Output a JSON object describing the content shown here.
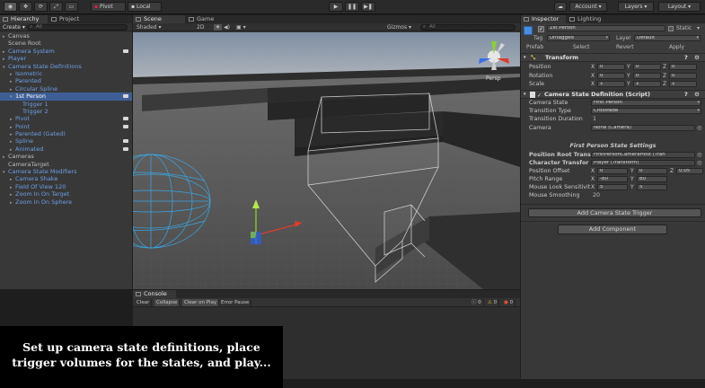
{
  "toolbar": {
    "pivot": "Pivot",
    "local": "Local",
    "account": "Account",
    "layers": "Layers",
    "layout": "Layout"
  },
  "hierarchy": {
    "tab": "Hierarchy",
    "project_tab": "Project",
    "create": "Create",
    "search_placeholder": "All",
    "items": [
      {
        "label": "Canvas",
        "indent": 0,
        "arrow": "▸",
        "blue": false
      },
      {
        "label": "Scene Root",
        "indent": 0,
        "arrow": "",
        "blue": false
      },
      {
        "label": "Camera System",
        "indent": 0,
        "arrow": "▸",
        "blue": true
      },
      {
        "label": "Player",
        "indent": 0,
        "arrow": "▸",
        "blue": true
      },
      {
        "label": "Camera State Definitions",
        "indent": 0,
        "arrow": "▾",
        "blue": true
      },
      {
        "label": "Isometric",
        "indent": 1,
        "arrow": "▸",
        "blue": true
      },
      {
        "label": "Parented",
        "indent": 1,
        "arrow": "▸",
        "blue": true
      },
      {
        "label": "Circular Spline",
        "indent": 1,
        "arrow": "▸",
        "blue": true
      },
      {
        "label": "1st Person",
        "indent": 1,
        "arrow": "▾",
        "blue": true,
        "selected": true
      },
      {
        "label": "Trigger 1",
        "indent": 2,
        "arrow": "",
        "blue": true
      },
      {
        "label": "Trigger 2",
        "indent": 2,
        "arrow": "",
        "blue": true
      },
      {
        "label": "Pivot",
        "indent": 1,
        "arrow": "▸",
        "blue": true
      },
      {
        "label": "Point",
        "indent": 1,
        "arrow": "▸",
        "blue": true
      },
      {
        "label": "Parented (Gated)",
        "indent": 1,
        "arrow": "▸",
        "blue": true
      },
      {
        "label": "Spline",
        "indent": 1,
        "arrow": "▸",
        "blue": true
      },
      {
        "label": "Animated",
        "indent": 1,
        "arrow": "▸",
        "blue": true
      },
      {
        "label": "Cameras",
        "indent": 0,
        "arrow": "▸",
        "blue": false
      },
      {
        "label": "CameraTarget",
        "indent": 0,
        "arrow": "",
        "blue": false
      },
      {
        "label": "Camera State Modifiers",
        "indent": 0,
        "arrow": "▾",
        "blue": true
      },
      {
        "label": "Camera Shake",
        "indent": 1,
        "arrow": "▸",
        "blue": true
      },
      {
        "label": "Field Of View 120",
        "indent": 1,
        "arrow": "▸",
        "blue": true
      },
      {
        "label": "Zoom In On Target",
        "indent": 1,
        "arrow": "▸",
        "blue": true
      },
      {
        "label": "Zoom In On Sphere",
        "indent": 1,
        "arrow": "▸",
        "blue": true
      }
    ]
  },
  "scene": {
    "tab": "Scene",
    "game_tab": "Game",
    "shading": "Shaded",
    "mode": "2D",
    "gizmos": "Gizmos",
    "search_placeholder": "All",
    "persp": "Persp"
  },
  "console": {
    "tab": "Console",
    "buttons": [
      "Clear",
      "Collapse",
      "Clear on Play",
      "Error Pause"
    ],
    "counts": [
      "0",
      "0",
      "0"
    ]
  },
  "inspector": {
    "tab": "Inspector",
    "lighting_tab": "Lighting",
    "object_name": "1st Person",
    "static_label": "Static",
    "tag_label": "Tag",
    "tag_value": "Untagged",
    "layer_label": "Layer",
    "layer_value": "Default",
    "prefab_label": "Prefab",
    "prefab_select": "Select",
    "prefab_revert": "Revert",
    "prefab_apply": "Apply",
    "transform": {
      "title": "Transform",
      "rows": [
        {
          "label": "Position",
          "x": "0",
          "y": "0",
          "z": "0"
        },
        {
          "label": "Rotation",
          "x": "0",
          "y": "0",
          "z": "0"
        },
        {
          "label": "Scale",
          "x": "1",
          "y": "1",
          "z": "1"
        }
      ]
    },
    "csd": {
      "title": "Camera State Definition (Script)",
      "camera_state_label": "Camera State",
      "camera_state_value": "First Person",
      "transition_type_label": "Transition Type",
      "transition_type_value": "Crossfade",
      "transition_duration_label": "Transition Duration",
      "transition_duration_value": "1",
      "camera_label": "Camera",
      "camera_value": "None (Camera)"
    },
    "fps": {
      "title": "First Person State Settings",
      "position_root_label": "Position Root Transi",
      "position_root_value": "FirstPersonCameraHost (Tran",
      "character_label": "Character Transfor",
      "character_value": "Player (Transform)",
      "position_offset_label": "Position Offset",
      "position_offset": {
        "x": "0",
        "y": "0",
        "z": "0.05"
      },
      "pitch_range_label": "Pitch Range",
      "pitch_range": {
        "x": "-80",
        "y": "80"
      },
      "mouse_look_label": "Mouse Look Sensitivit",
      "mouse_look": {
        "x": "5",
        "y": "5"
      },
      "mouse_smoothing_label": "Mouse Smoothing",
      "mouse_smoothing_value": "20"
    },
    "add_trigger": "Add Camera State Trigger",
    "add_component": "Add Component"
  },
  "caption": {
    "line1": "Set up camera state definitions, place",
    "line2": "trigger volumes for the states, and play..."
  },
  "colors": {
    "selection": "#3e5f96",
    "prefab_blue": "#6f9fe6",
    "sphere_wire": "#3aa7e6"
  }
}
